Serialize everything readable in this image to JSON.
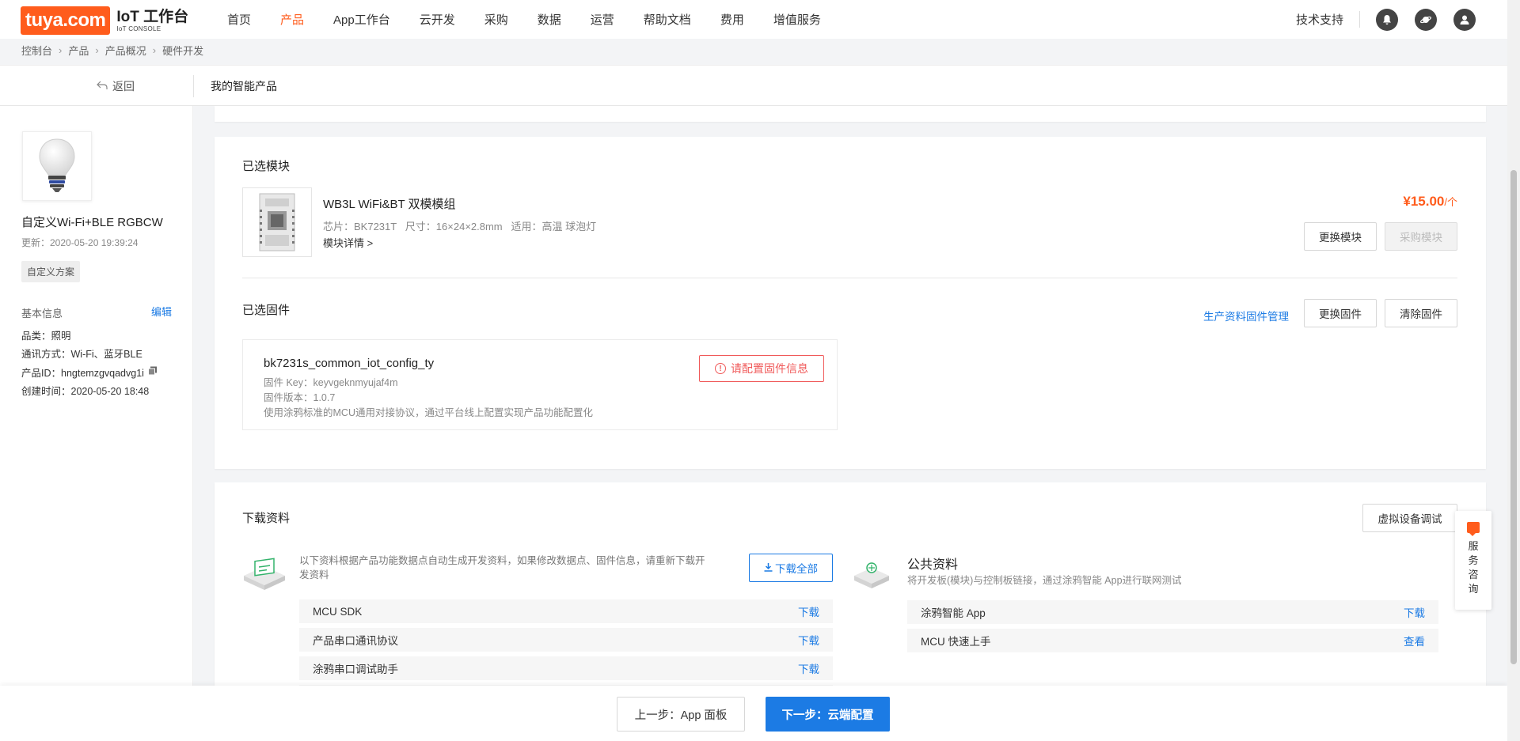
{
  "brand": {
    "logo": "tuya.com",
    "title": "IoT 工作台",
    "subtitle": "IoT CONSOLE",
    "accent_color": "#ff5c1c",
    "link_color": "#1c7be4"
  },
  "nav": {
    "items": [
      {
        "label": "首页",
        "active": false
      },
      {
        "label": "产品",
        "active": true
      },
      {
        "label": "App工作台",
        "active": false
      },
      {
        "label": "云开发",
        "active": false
      },
      {
        "label": "采购",
        "active": false
      },
      {
        "label": "数据",
        "active": false
      },
      {
        "label": "运营",
        "active": false
      },
      {
        "label": "帮助文档",
        "active": false
      },
      {
        "label": "费用",
        "active": false
      },
      {
        "label": "增值服务",
        "active": false
      }
    ],
    "support": "技术支持",
    "icons": [
      "bell-icon",
      "planet-icon",
      "user-icon"
    ]
  },
  "breadcrumb": [
    "控制台",
    "产品",
    "产品概况",
    "硬件开发"
  ],
  "subheader": {
    "back": "返回",
    "title": "我的智能产品"
  },
  "product": {
    "name": "自定义Wi-Fi+BLE RGBCW",
    "updated": "更新：2020-05-20 19:39:24",
    "tag": "自定义方案",
    "basic_info_title": "基本信息",
    "edit": "编辑",
    "category": "品类：照明",
    "protocol": "通讯方式：Wi-Fi、蓝牙BLE",
    "product_id": "产品ID：hngtemzgvqadvg1i",
    "created": "创建时间：2020-05-20 18:48"
  },
  "module": {
    "section_title": "已选模块",
    "name": "WB3L WiFi&BT 双模模组",
    "spec": "芯片：BK7231T   尺寸：16×24×2.8mm   适用：高温 球泡灯",
    "detail": "模块详情 >",
    "price": "¥15.00",
    "price_unit": "/个",
    "change": "更换模块",
    "buy": "采购模块"
  },
  "firmware": {
    "section_title": "已选固件",
    "manage_link": "生产资料固件管理",
    "change": "更换固件",
    "clear": "清除固件",
    "name": "bk7231s_common_iot_config_ty",
    "key": "固件 Key：keyvgeknmyujaf4m",
    "version": "固件版本：1.0.7",
    "description": "使用涂鸦标准的MCU通用对接协议，通过平台线上配置实现产品功能配置化",
    "warning": "请配置固件信息"
  },
  "downloads": {
    "section_title": "下载资料",
    "virtual_debug": "虚拟设备调试",
    "description": "以下资料根据产品功能数据点自动生成开发资料，如果修改数据点、固件信息，请重新下载开发资料",
    "download_all": "下载全部",
    "items": [
      {
        "name": "MCU SDK",
        "action": "下载"
      },
      {
        "name": "产品串口通讯协议",
        "action": "下载"
      },
      {
        "name": "涂鸦串口调试助手",
        "action": "下载"
      }
    ],
    "public": {
      "title": "公共资料",
      "description": "将开发板(模块)与控制板链接，通过涂鸦智能 App进行联网测试",
      "items": [
        {
          "name": "涂鸦智能 App",
          "action": "下载"
        },
        {
          "name": "MCU 快速上手",
          "action": "查看"
        }
      ]
    }
  },
  "service": {
    "label": "服务咨询"
  },
  "footer": {
    "prev": "上一步：App 面板",
    "next": "下一步：云端配置"
  }
}
